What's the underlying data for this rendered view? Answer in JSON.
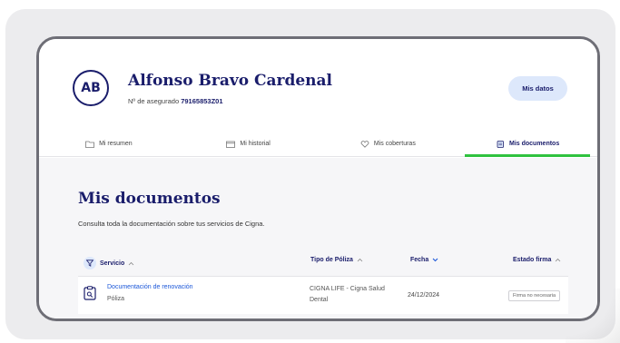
{
  "user": {
    "initials": "AB",
    "name": "Alfonso Bravo Cardenal",
    "policy_label": "Nº de asegurado",
    "policy_number": "79165853Z01"
  },
  "header": {
    "mis_datos_label": "Mis datos"
  },
  "tabs": [
    {
      "label": "Mi resumen",
      "icon": "folder-icon",
      "active": false
    },
    {
      "label": "Mi historial",
      "icon": "calendar-icon",
      "active": false
    },
    {
      "label": "Mis coberturas",
      "icon": "heart-icon",
      "active": false
    },
    {
      "label": "Mis documentos",
      "icon": "document-icon",
      "active": true
    }
  ],
  "main": {
    "title": "Mis documentos",
    "subtitle": "Consulta toda la documentación sobre tus servicios de Cigna."
  },
  "table": {
    "columns": [
      {
        "label": "Servicio",
        "sort": "up"
      },
      {
        "label": "Tipo de Póliza",
        "sort": "up"
      },
      {
        "label": "Fecha",
        "sort": "down-active"
      },
      {
        "label": "Estado firma",
        "sort": "up"
      }
    ],
    "rows": [
      {
        "service": "Documentación de renovación",
        "service_sub": "Póliza",
        "policy_type": "CIGNA LIFE - Cigna Salud Dental",
        "date": "24/12/2024",
        "status": "Firma no necesaria"
      }
    ]
  },
  "colors": {
    "brand": "#1a1d6b",
    "accent_green": "#2fc23f",
    "link": "#1b57d8",
    "pill": "#dde8fb"
  }
}
